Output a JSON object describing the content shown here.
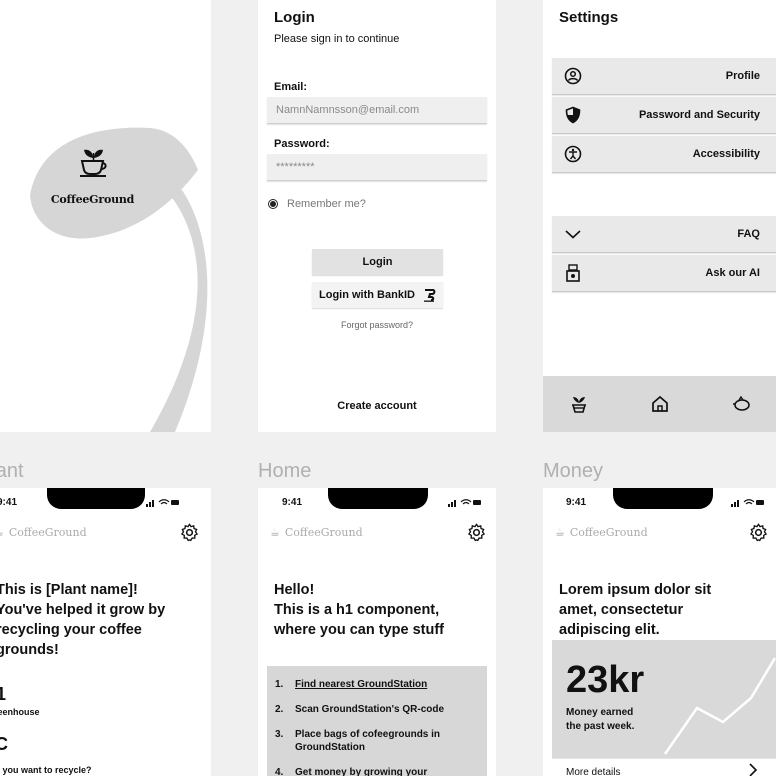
{
  "splash": {
    "brand": "CoffeeGround"
  },
  "login": {
    "title": "Login",
    "subtitle": "Please sign in to continue",
    "email_label": "Email:",
    "email_value": "NamnNamnsson@email.com",
    "password_label": "Password:",
    "password_value": "*********",
    "remember": "Remember me?",
    "login_button": "Login",
    "bankid_button": "Login with BankID",
    "forgot": "Forgot password?",
    "create": "Create account"
  },
  "settings": {
    "title": "Settings",
    "items": [
      {
        "label": "Profile",
        "icon": "profile-icon"
      },
      {
        "label": "Password and Security",
        "icon": "shield-icon"
      },
      {
        "label": "Accessibility",
        "icon": "accessibility-icon"
      },
      {
        "label": "FAQ",
        "icon": "chevron-down-icon"
      },
      {
        "label": "Ask our AI",
        "icon": "robot-icon"
      }
    ],
    "nav": [
      "plant-icon",
      "home-icon",
      "piggy-bank-icon"
    ]
  },
  "sections": {
    "plant": "Plant",
    "home": "Home",
    "money": "Money"
  },
  "status_time": "9:41",
  "brand": "CoffeeGround",
  "plant": {
    "heading_lines": [
      "This is [Plant name]!",
      "You've helped it grow by",
      "recycling your coffee",
      "grounds!"
    ],
    "stat1_value": "1",
    "stat1_label": "Greenhouse",
    "stat2_value": "C",
    "stat2_label": "Do you want to recycle?"
  },
  "home": {
    "heading_lines": [
      "Hello!",
      "This is a h1 component,",
      "where you can type stuff"
    ],
    "steps": [
      {
        "n": "1.",
        "text": "Find nearest GroundStation",
        "link": true
      },
      {
        "n": "2.",
        "text": "Scan GroundStation's QR-code",
        "link": false
      },
      {
        "n": "3.",
        "text": "Place bags of cofeegrounds in GroundStation",
        "link": false
      },
      {
        "n": "4.",
        "text": "Get money by growing your",
        "link": false
      }
    ]
  },
  "money": {
    "heading_lines": [
      "Lorem ipsum dolor sit",
      "amet, consectetur",
      "adipiscing elit."
    ],
    "amount": "23kr",
    "caption_lines": [
      "Money earned",
      "the past week."
    ],
    "more": "More details"
  }
}
